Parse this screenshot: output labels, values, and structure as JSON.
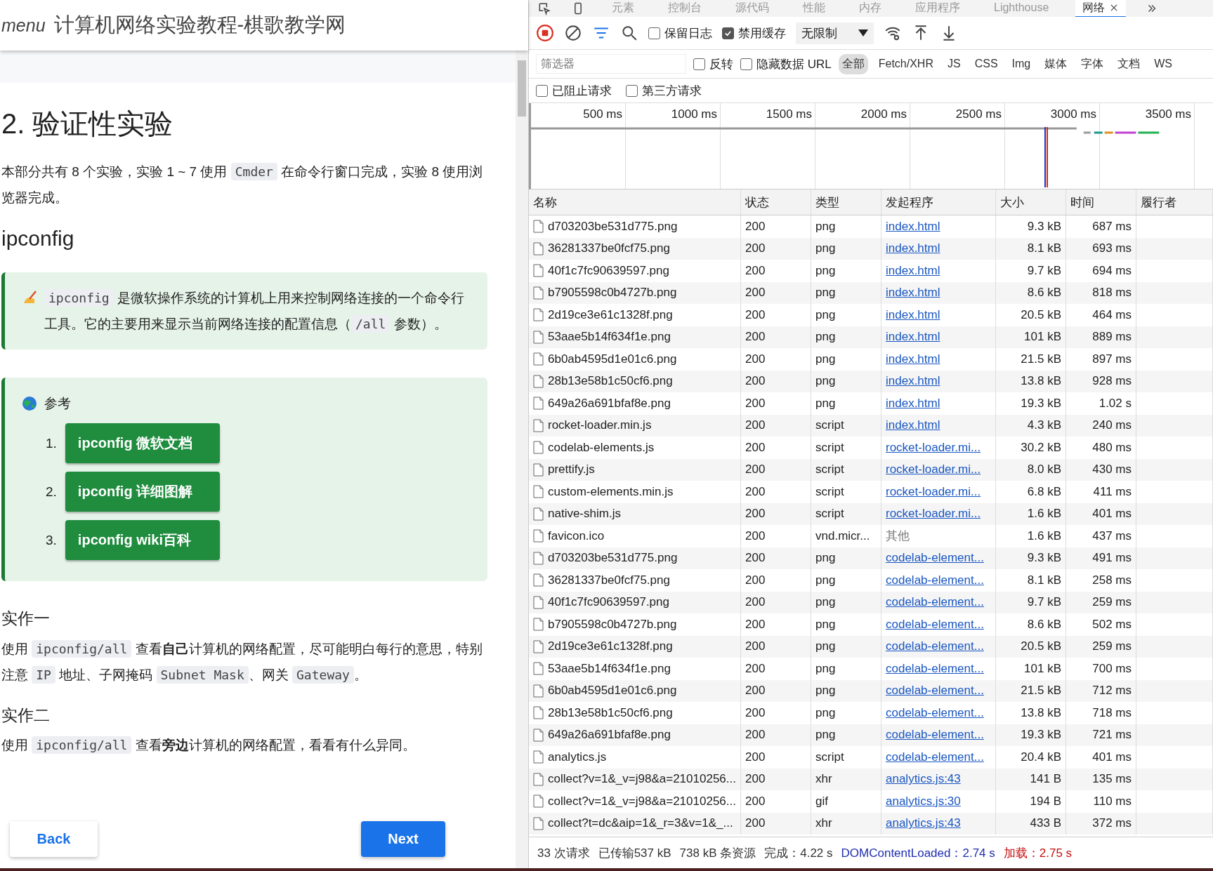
{
  "page": {
    "menu_label": "menu",
    "title": "计算机网络实验教程-棋歌教学网",
    "heading": "2. 验证性实验",
    "intro": [
      {
        "t": "本部分共有 8 个实验，实验 1 ~ 7 使用 "
      },
      {
        "code": "Cmder"
      },
      {
        "t": " 在命令行窗口完成，实验 8 使用浏览器完成。"
      }
    ],
    "subheading": "ipconfig",
    "tip": [
      {
        "code": "ipconfig"
      },
      {
        "t": " 是微软操作系统的计算机上用来控制网络连接的一个命令行工具。它的主要用来显示当前网络连接的配置信息（"
      },
      {
        "code": "/all"
      },
      {
        "t": " 参数）。"
      }
    ],
    "reference": {
      "title": "参考",
      "items": [
        {
          "number": "1.",
          "label": "ipconfig 微软文档"
        },
        {
          "number": "2.",
          "label": "ipconfig 详细图解"
        },
        {
          "number": "3.",
          "label": "ipconfig wiki百科"
        }
      ]
    },
    "tasks": [
      {
        "title": "实作一",
        "text": [
          {
            "t": "使用 "
          },
          {
            "code": "ipconfig/all"
          },
          {
            "t": " 查看**自己**计算机的网络配置，尽可能明白每行的意思，特别注意 "
          },
          {
            "code": "IP"
          },
          {
            "t": " 地址、子网掩码 "
          },
          {
            "code": "Subnet Mask"
          },
          {
            "t": "、网关 "
          },
          {
            "code": "Gateway"
          },
          {
            "t": "。"
          }
        ]
      },
      {
        "title": "实作二",
        "text": [
          {
            "t": "使用 "
          },
          {
            "code": "ipconfig/all"
          },
          {
            "t": " 查看**旁边**计算机的网络配置，看看有什么异同。"
          }
        ]
      }
    ],
    "nav": {
      "back": "Back",
      "next": "Next"
    }
  },
  "devtools": {
    "tabs": [
      {
        "label": "元素",
        "selected": false
      },
      {
        "label": "控制台",
        "selected": false
      },
      {
        "label": "源代码",
        "selected": false
      },
      {
        "label": "性能",
        "selected": false
      },
      {
        "label": "内存",
        "selected": false
      },
      {
        "label": "应用程序",
        "selected": false
      },
      {
        "label": "Lighthouse",
        "selected": false
      },
      {
        "label": "网络",
        "selected": true,
        "closable": true
      }
    ],
    "toolbar": {
      "preserve_log": {
        "label": "保留日志",
        "checked": false
      },
      "disable_cache": {
        "label": "禁用缓存",
        "checked": true
      },
      "throttling": "无限制"
    },
    "filter": {
      "placeholder": "筛选器",
      "invert": {
        "label": "反转",
        "checked": false
      },
      "hide_data_urls": {
        "label": "隐藏数据 URL",
        "checked": false
      },
      "types": [
        {
          "label": "全部",
          "selected": true
        },
        {
          "label": "Fetch/XHR",
          "selected": false
        },
        {
          "label": "JS",
          "selected": false
        },
        {
          "label": "CSS",
          "selected": false
        },
        {
          "label": "Img",
          "selected": false
        },
        {
          "label": "媒体",
          "selected": false
        },
        {
          "label": "字体",
          "selected": false
        },
        {
          "label": "文档",
          "selected": false
        },
        {
          "label": "WS",
          "selected": false
        }
      ],
      "blocked_requests": {
        "label": "已阻止请求",
        "checked": false
      },
      "third_party": {
        "label": "第三方请求",
        "checked": false
      }
    },
    "timeline_ticks": [
      "500 ms",
      "1000 ms",
      "1500 ms",
      "2000 ms",
      "2500 ms",
      "3000 ms",
      "3500 ms"
    ],
    "columns": [
      "名称",
      "状态",
      "类型",
      "发起程序",
      "大小",
      "时间",
      "履行者"
    ],
    "rows": [
      {
        "name": "d703203be531d775.png",
        "status": "200",
        "type": "png",
        "initiator": "index.html",
        "link": true,
        "size": "9.3 kB",
        "time": "687 ms"
      },
      {
        "name": "36281337be0fcf75.png",
        "status": "200",
        "type": "png",
        "initiator": "index.html",
        "link": true,
        "size": "8.1 kB",
        "time": "693 ms"
      },
      {
        "name": "40f1c7fc90639597.png",
        "status": "200",
        "type": "png",
        "initiator": "index.html",
        "link": true,
        "size": "9.7 kB",
        "time": "694 ms"
      },
      {
        "name": "b7905598c0b4727b.png",
        "status": "200",
        "type": "png",
        "initiator": "index.html",
        "link": true,
        "size": "8.6 kB",
        "time": "818 ms"
      },
      {
        "name": "2d19ce3e61c1328f.png",
        "status": "200",
        "type": "png",
        "initiator": "index.html",
        "link": true,
        "size": "20.5 kB",
        "time": "464 ms"
      },
      {
        "name": "53aae5b14f634f1e.png",
        "status": "200",
        "type": "png",
        "initiator": "index.html",
        "link": true,
        "size": "101 kB",
        "time": "889 ms"
      },
      {
        "name": "6b0ab4595d1e01c6.png",
        "status": "200",
        "type": "png",
        "initiator": "index.html",
        "link": true,
        "size": "21.5 kB",
        "time": "897 ms"
      },
      {
        "name": "28b13e58b1c50cf6.png",
        "status": "200",
        "type": "png",
        "initiator": "index.html",
        "link": true,
        "size": "13.8 kB",
        "time": "928 ms"
      },
      {
        "name": "649a26a691bfaf8e.png",
        "status": "200",
        "type": "png",
        "initiator": "index.html",
        "link": true,
        "size": "19.3 kB",
        "time": "1.02 s"
      },
      {
        "name": "rocket-loader.min.js",
        "status": "200",
        "type": "script",
        "initiator": "index.html",
        "link": true,
        "size": "4.3 kB",
        "time": "240 ms"
      },
      {
        "name": "codelab-elements.js",
        "status": "200",
        "type": "script",
        "initiator": "rocket-loader.mi...",
        "link": true,
        "size": "30.2 kB",
        "time": "480 ms"
      },
      {
        "name": "prettify.js",
        "status": "200",
        "type": "script",
        "initiator": "rocket-loader.mi...",
        "link": true,
        "size": "8.0 kB",
        "time": "430 ms"
      },
      {
        "name": "custom-elements.min.js",
        "status": "200",
        "type": "script",
        "initiator": "rocket-loader.mi...",
        "link": true,
        "size": "6.8 kB",
        "time": "411 ms"
      },
      {
        "name": "native-shim.js",
        "status": "200",
        "type": "script",
        "initiator": "rocket-loader.mi...",
        "link": true,
        "size": "1.6 kB",
        "time": "401 ms"
      },
      {
        "name": "favicon.ico",
        "status": "200",
        "type": "vnd.micr...",
        "initiator": "其他",
        "link": false,
        "size": "1.6 kB",
        "time": "437 ms"
      },
      {
        "name": "d703203be531d775.png",
        "status": "200",
        "type": "png",
        "initiator": "codelab-element...",
        "link": true,
        "size": "9.3 kB",
        "time": "491 ms"
      },
      {
        "name": "36281337be0fcf75.png",
        "status": "200",
        "type": "png",
        "initiator": "codelab-element...",
        "link": true,
        "size": "8.1 kB",
        "time": "258 ms"
      },
      {
        "name": "40f1c7fc90639597.png",
        "status": "200",
        "type": "png",
        "initiator": "codelab-element...",
        "link": true,
        "size": "9.7 kB",
        "time": "259 ms"
      },
      {
        "name": "b7905598c0b4727b.png",
        "status": "200",
        "type": "png",
        "initiator": "codelab-element...",
        "link": true,
        "size": "8.6 kB",
        "time": "502 ms"
      },
      {
        "name": "2d19ce3e61c1328f.png",
        "status": "200",
        "type": "png",
        "initiator": "codelab-element...",
        "link": true,
        "size": "20.5 kB",
        "time": "259 ms"
      },
      {
        "name": "53aae5b14f634f1e.png",
        "status": "200",
        "type": "png",
        "initiator": "codelab-element...",
        "link": true,
        "size": "101 kB",
        "time": "700 ms"
      },
      {
        "name": "6b0ab4595d1e01c6.png",
        "status": "200",
        "type": "png",
        "initiator": "codelab-element...",
        "link": true,
        "size": "21.5 kB",
        "time": "712 ms"
      },
      {
        "name": "28b13e58b1c50cf6.png",
        "status": "200",
        "type": "png",
        "initiator": "codelab-element...",
        "link": true,
        "size": "13.8 kB",
        "time": "718 ms"
      },
      {
        "name": "649a26a691bfaf8e.png",
        "status": "200",
        "type": "png",
        "initiator": "codelab-element...",
        "link": true,
        "size": "19.3 kB",
        "time": "721 ms"
      },
      {
        "name": "analytics.js",
        "status": "200",
        "type": "script",
        "initiator": "codelab-element...",
        "link": true,
        "size": "20.4 kB",
        "time": "401 ms"
      },
      {
        "name": "collect?v=1&_v=j98&a=21010256...",
        "status": "200",
        "type": "xhr",
        "initiator": "analytics.js:43",
        "link": true,
        "size": "141 B",
        "time": "135 ms"
      },
      {
        "name": "collect?v=1&_v=j98&a=21010256...",
        "status": "200",
        "type": "gif",
        "initiator": "analytics.js:30",
        "link": true,
        "size": "194 B",
        "time": "110 ms"
      },
      {
        "name": "collect?t=dc&aip=1&_r=3&v=1&_...",
        "status": "200",
        "type": "xhr",
        "initiator": "analytics.js:43",
        "link": true,
        "size": "433 B",
        "time": "372 ms"
      }
    ],
    "status_bar": [
      {
        "text": "33 次请求",
        "kind": "plain"
      },
      {
        "text": "已传输537 kB",
        "kind": "plain"
      },
      {
        "text": "738 kB 条资源",
        "kind": "plain"
      },
      {
        "text": "完成：4.22 s",
        "kind": "plain"
      },
      {
        "text": "DOMContentLoaded：2.74 s",
        "kind": "dom"
      },
      {
        "text": "加载：2.75 s",
        "kind": "load"
      }
    ]
  }
}
